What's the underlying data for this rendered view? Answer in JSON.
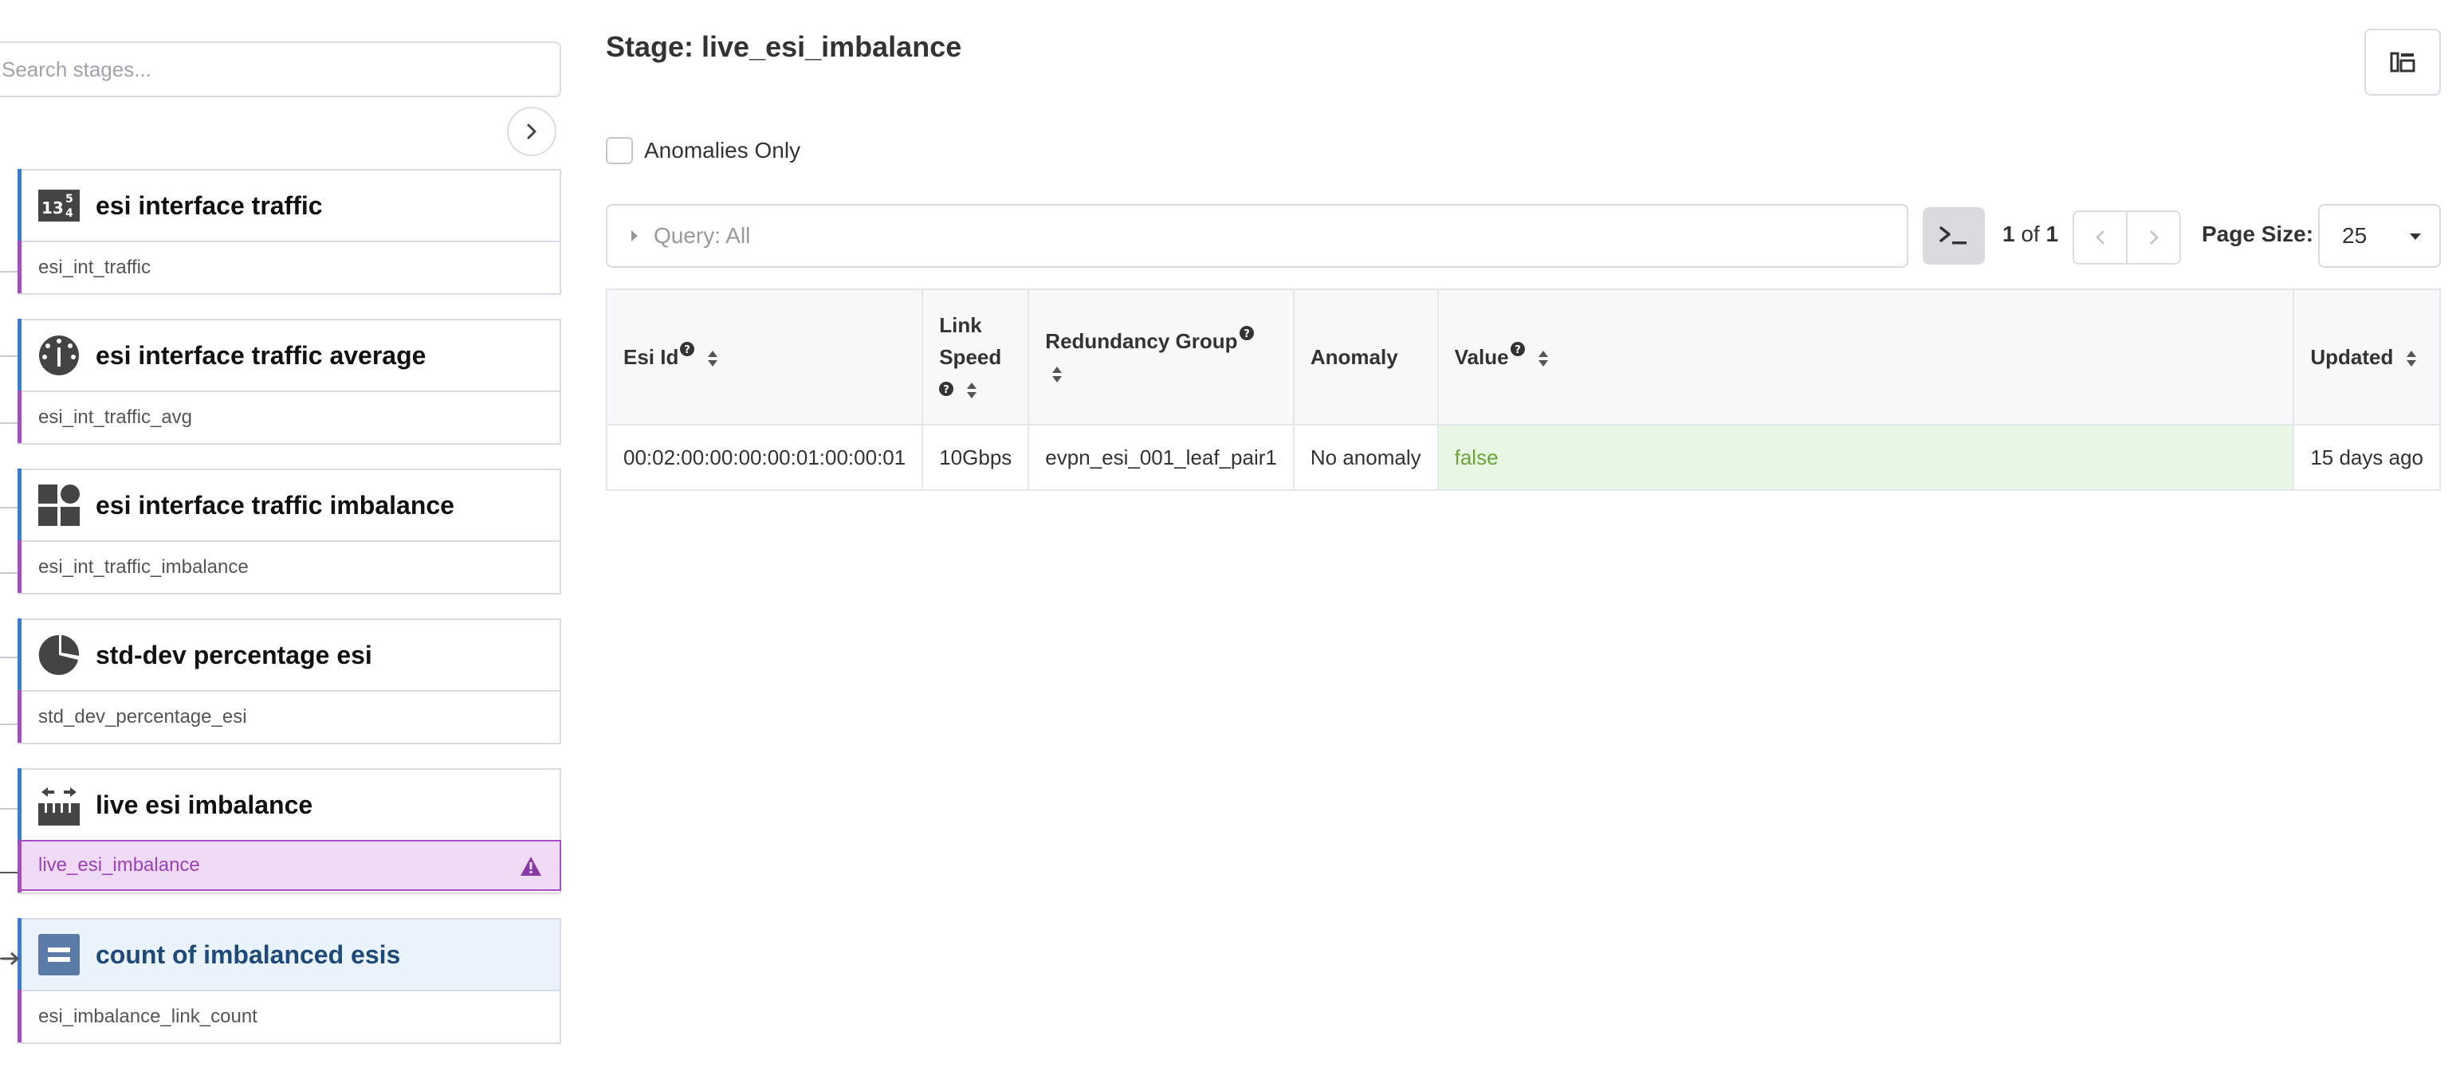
{
  "sidebar": {
    "search_placeholder": "Search stages...",
    "stages": [
      {
        "title": "esi interface traffic",
        "name": "esi_int_traffic",
        "icon": "numbers-table-icon"
      },
      {
        "title": "esi interface traffic average",
        "name": "esi_int_traffic_avg",
        "icon": "gauge-icon"
      },
      {
        "title": "esi interface traffic imbalance",
        "name": "esi_int_traffic_imbalance",
        "icon": "blocks-icon"
      },
      {
        "title": "std-dev percentage esi",
        "name": "std_dev_percentage_esi",
        "icon": "pie-chart-icon"
      },
      {
        "title": "live esi imbalance",
        "name": "live_esi_imbalance",
        "icon": "ruler-arrows-icon"
      },
      {
        "title": "count of imbalanced esis",
        "name": "esi_imbalance_link_count",
        "icon": "equals-icon"
      }
    ]
  },
  "main": {
    "title": "Stage: live_esi_imbalance",
    "anomalies_only_label": "Anomalies Only",
    "query_label": "Query: All",
    "pager": {
      "current": "1",
      "of_label": "of",
      "total": "1"
    },
    "page_size_label": "Page Size:",
    "page_size_value": "25"
  },
  "table": {
    "headers": {
      "esi_id": "Esi Id",
      "link_speed_1": "Link",
      "link_speed_2": "Speed",
      "redundancy_group": "Redundancy Group",
      "anomaly": "Anomaly",
      "value": "Value",
      "updated": "Updated"
    },
    "rows": [
      {
        "esi_id": "00:02:00:00:00:00:01:00:00:01",
        "link_speed": "10Gbps",
        "redundancy_group": "evpn_esi_001_leaf_pair1",
        "anomaly": "No anomaly",
        "value": "false",
        "updated": "15 days ago"
      }
    ]
  },
  "colors": {
    "accent_blue": "#3a7bd5",
    "accent_purple": "#a64cc4",
    "value_green": "#6aa538",
    "value_bg": "#e8f6e4"
  }
}
